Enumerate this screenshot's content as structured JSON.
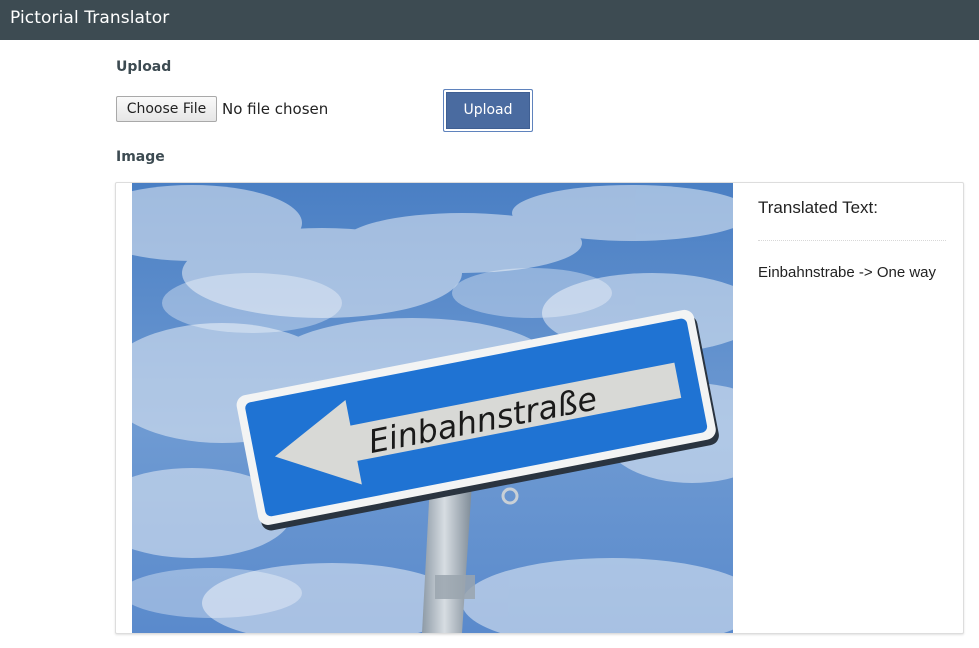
{
  "app": {
    "title": "Pictorial Translator"
  },
  "upload_section": {
    "label": "Upload",
    "choose_file_label": "Choose File",
    "file_status": "No file chosen",
    "upload_button": "Upload"
  },
  "image_section": {
    "label": "Image",
    "sign_text": "Einbahnstraße",
    "translated_heading": "Translated Text:",
    "translation": "Einbahnstrabe -> One way"
  },
  "colors": {
    "topbar": "#3d4b52",
    "upload_button": "#4a6ba0",
    "sign_blue": "#1f73d3",
    "sky": "#4c86cc"
  }
}
